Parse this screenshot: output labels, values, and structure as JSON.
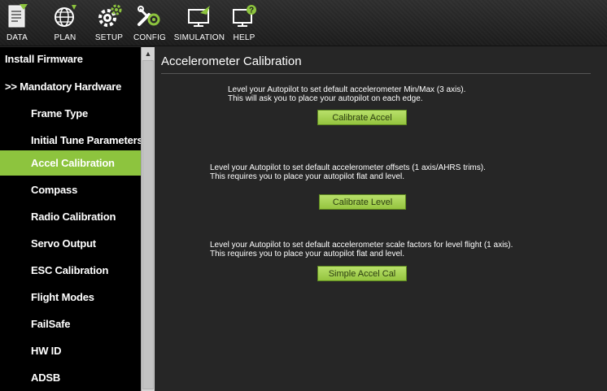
{
  "toolbar": {
    "items": [
      {
        "label": "DATA",
        "icon": "data-icon"
      },
      {
        "label": "PLAN",
        "icon": "globe-icon"
      },
      {
        "label": "SETUP",
        "icon": "setup-gear-icon"
      },
      {
        "label": "CONFIG",
        "icon": "wrench-icon"
      },
      {
        "label": "SIMULATION",
        "icon": "monitor-plane-icon"
      },
      {
        "label": "HELP",
        "icon": "monitor-help-icon"
      }
    ]
  },
  "sidebar": {
    "items": [
      {
        "label": "Install Firmware",
        "level": "top"
      },
      {
        "label": ">> Mandatory Hardware",
        "level": "top"
      },
      {
        "label": "Frame Type",
        "level": "sub"
      },
      {
        "label": "Initial Tune Parameters",
        "level": "sub"
      },
      {
        "label": "Accel Calibration",
        "level": "sub",
        "active": true
      },
      {
        "label": "Compass",
        "level": "sub"
      },
      {
        "label": "Radio Calibration",
        "level": "sub"
      },
      {
        "label": "Servo Output",
        "level": "sub"
      },
      {
        "label": "ESC Calibration",
        "level": "sub"
      },
      {
        "label": "Flight Modes",
        "level": "sub"
      },
      {
        "label": "FailSafe",
        "level": "sub"
      },
      {
        "label": "HW ID",
        "level": "sub"
      },
      {
        "label": "ADSB",
        "level": "sub"
      }
    ]
  },
  "main": {
    "title": "Accelerometer Calibration",
    "sections": [
      {
        "line1": "Level your Autopilot to set default accelerometer Min/Max (3 axis).",
        "line2": "This will ask you to place your autopilot on each edge.",
        "button": "Calibrate Accel"
      },
      {
        "line1": "Level your Autopilot to set default accelerometer offsets (1 axis/AHRS trims).",
        "line2": "This requires you to place your autopilot flat and level.",
        "button": "Calibrate Level"
      },
      {
        "line1": "Level your Autopilot to set default accelerometer scale factors for level flight (1 axis).",
        "line2": "This requires you to place your autopilot flat and level.",
        "button": "Simple Accel Cal"
      }
    ]
  },
  "colors": {
    "accent": "#8dc43e",
    "background": "#262626",
    "sidebar": "#000000",
    "button": "#a8d455"
  }
}
